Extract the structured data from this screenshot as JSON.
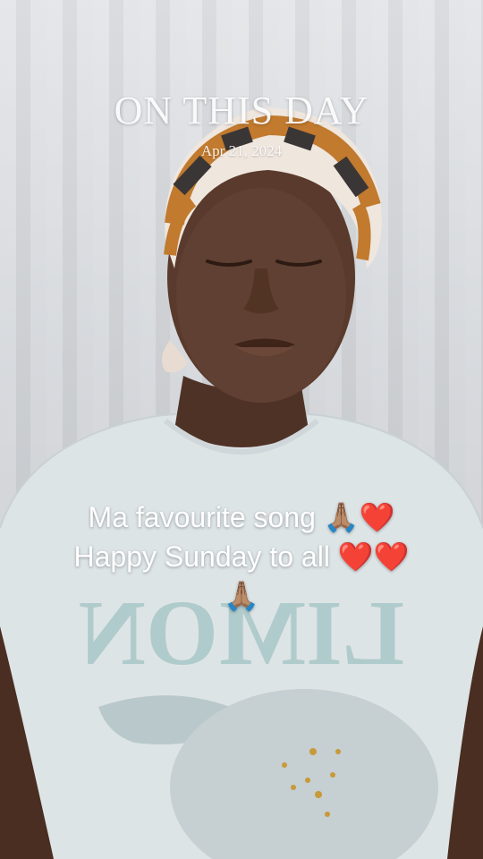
{
  "overlay": {
    "title": "ON THIS DAY",
    "date": "Apr 21, 2024"
  },
  "caption": {
    "line1": "Ma favourite song 🙏🏽❤️",
    "line2": "Happy Sunday to all ❤️❤️",
    "line3": "🙏🏽"
  },
  "shirt_print": {
    "text": "LIMON"
  },
  "colors": {
    "shirt": "#dfe6e8",
    "headwrap_orange": "#c17a2e",
    "headwrap_dark": "#3b3636",
    "skin": "#5a3a2c",
    "print_teal": "#a9c7c8"
  }
}
